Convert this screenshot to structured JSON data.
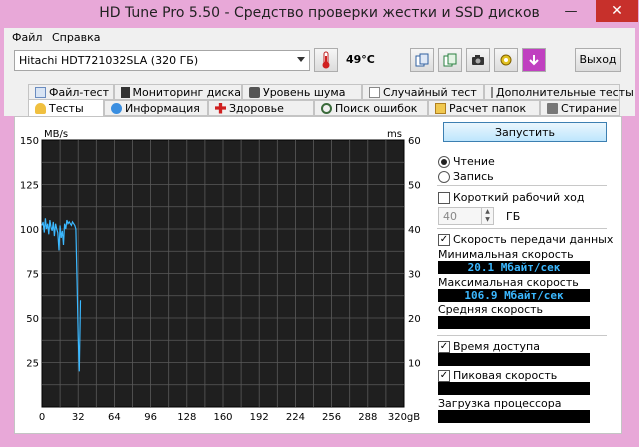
{
  "window": {
    "title": "HD Tune Pro 5.50 - Средство проверки жестки и SSD дисков"
  },
  "menu": {
    "file": "Файл",
    "help": "Справка"
  },
  "toolbar": {
    "drive": "Hitachi HDT721032SLA (320 ГБ)",
    "temperature": "49°C",
    "exit_label": "Выход"
  },
  "tabs_top": [
    "Файл-тест",
    "Мониторинг диска",
    "Уровень шума",
    "Случайный тест",
    "Дополнительные тесты"
  ],
  "tabs_bottom": [
    "Тесты",
    "Информация",
    "Здоровье",
    "Поиск ошибок",
    "Расчет папок",
    "Стирание"
  ],
  "panel": {
    "start_label": "Запустить",
    "read_label": "Чтение",
    "write_label": "Запись",
    "short_stroke_label": "Короткий рабочий ход",
    "short_stroke_value": "40",
    "short_stroke_unit": "ГБ",
    "transfer_rate_label": "Скорость передачи данных",
    "min_speed_label": "Минимальная скорость",
    "min_speed_value": "20.1 Мбайт/сек",
    "max_speed_label": "Максимальная скорость",
    "max_speed_value": "106.9 Мбайт/сек",
    "avg_speed_label": "Средняя скорость",
    "avg_speed_value": "",
    "access_time_label": "Время доступа",
    "access_time_value": "",
    "burst_rate_label": "Пиковая скорость",
    "burst_rate_value": "",
    "cpu_usage_label": "Загрузка процессора",
    "cpu_usage_value": ""
  },
  "colors": {
    "chart_bg": "#1f1f1f",
    "grid": "#5a5a5a",
    "line": "#3bb8ff",
    "accent": "#3c7fb1"
  },
  "chart_data": {
    "type": "line",
    "ylabel": "MB/s",
    "y2label": "ms",
    "ylim": [
      0,
      150
    ],
    "y2lim": [
      0,
      60
    ],
    "xlim": [
      0,
      320
    ],
    "x_ticks": [
      "0",
      "32",
      "64",
      "96",
      "128",
      "160",
      "192",
      "224",
      "256",
      "288",
      "320gB"
    ],
    "y_ticks": [
      "150",
      "125",
      "100",
      "75",
      "50",
      "25"
    ],
    "y2_ticks": [
      "60",
      "50",
      "40",
      "30",
      "20",
      "10"
    ],
    "series": [
      {
        "x": [
          0,
          1,
          2,
          3,
          4,
          5,
          6,
          7,
          8,
          9,
          10,
          11,
          12,
          13,
          14,
          15,
          16,
          17,
          18,
          19,
          20,
          21,
          22,
          23,
          24,
          25,
          26,
          27,
          28,
          29,
          30,
          31,
          32,
          33,
          34
        ],
        "y": [
          102,
          104,
          98,
          106,
          100,
          103,
          97,
          105,
          101,
          99,
          104,
          96,
          103,
          100,
          98,
          88,
          102,
          95,
          99,
          91,
          103,
          100,
          105,
          103,
          104,
          103,
          102,
          104,
          103,
          102,
          100,
          70,
          40,
          20,
          60
        ]
      }
    ]
  }
}
